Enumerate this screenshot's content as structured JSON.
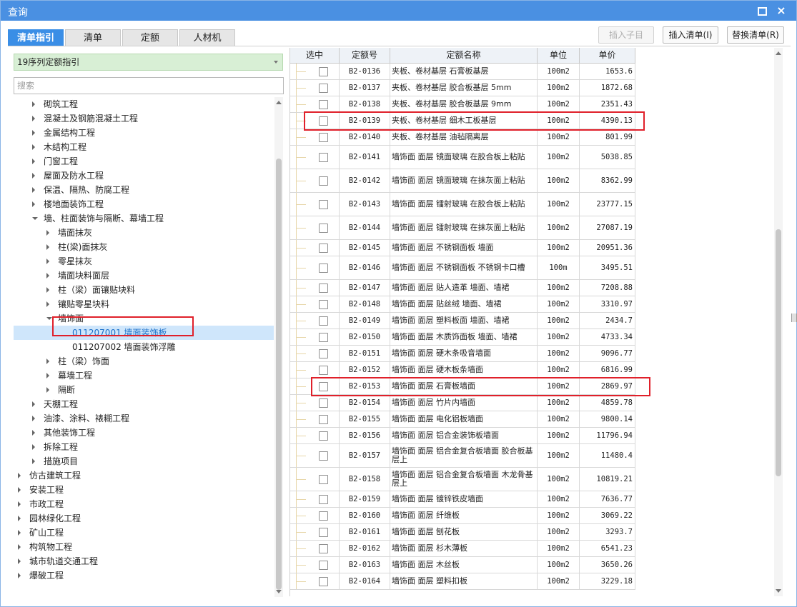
{
  "window": {
    "title": "查询"
  },
  "tabs": [
    {
      "label": "清单指引",
      "active": true
    },
    {
      "label": "清单",
      "active": false
    },
    {
      "label": "定额",
      "active": false
    },
    {
      "label": "人材机",
      "active": false
    }
  ],
  "toolbar": {
    "insert_child_label": "插入子目",
    "insert_list_label": "插入清单(I)",
    "replace_list_label": "替换清单(R)"
  },
  "left": {
    "dropdown_value": "19序列定额指引",
    "search_placeholder": "搜索"
  },
  "tree": [
    {
      "label": "砌筑工程",
      "level": 1,
      "state": "collapsed"
    },
    {
      "label": "混凝土及钢筋混凝土工程",
      "level": 1,
      "state": "collapsed"
    },
    {
      "label": "金属结构工程",
      "level": 1,
      "state": "collapsed"
    },
    {
      "label": "木结构工程",
      "level": 1,
      "state": "collapsed"
    },
    {
      "label": "门窗工程",
      "level": 1,
      "state": "collapsed"
    },
    {
      "label": "屋面及防水工程",
      "level": 1,
      "state": "collapsed"
    },
    {
      "label": "保温、隔热、防腐工程",
      "level": 1,
      "state": "collapsed"
    },
    {
      "label": "楼地面装饰工程",
      "level": 1,
      "state": "collapsed"
    },
    {
      "label": "墙、柱面装饰与隔断、幕墙工程",
      "level": 1,
      "state": "expanded"
    },
    {
      "label": "墙面抹灰",
      "level": 2,
      "state": "collapsed"
    },
    {
      "label": "柱(梁)面抹灰",
      "level": 2,
      "state": "collapsed"
    },
    {
      "label": "零星抹灰",
      "level": 2,
      "state": "collapsed"
    },
    {
      "label": "墙面块料面层",
      "level": 2,
      "state": "collapsed"
    },
    {
      "label": "柱（梁）面镶贴块料",
      "level": 2,
      "state": "collapsed"
    },
    {
      "label": "镶贴零星块料",
      "level": 2,
      "state": "collapsed"
    },
    {
      "label": "墙饰面",
      "level": 2,
      "state": "expanded"
    },
    {
      "label": "011207001  墙面装饰板",
      "level": 3,
      "state": "leaf",
      "selected": true,
      "highlighted": true
    },
    {
      "label": "011207002  墙面装饰浮雕",
      "level": 3,
      "state": "leaf"
    },
    {
      "label": "柱（梁）饰面",
      "level": 2,
      "state": "collapsed"
    },
    {
      "label": "幕墙工程",
      "level": 2,
      "state": "collapsed"
    },
    {
      "label": "隔断",
      "level": 2,
      "state": "collapsed"
    },
    {
      "label": "天棚工程",
      "level": 1,
      "state": "collapsed"
    },
    {
      "label": "油漆、涂料、裱糊工程",
      "level": 1,
      "state": "collapsed"
    },
    {
      "label": "其他装饰工程",
      "level": 1,
      "state": "collapsed"
    },
    {
      "label": "拆除工程",
      "level": 1,
      "state": "collapsed"
    },
    {
      "label": "措施项目",
      "level": 1,
      "state": "collapsed"
    },
    {
      "label": "仿古建筑工程",
      "level": 0,
      "state": "collapsed"
    },
    {
      "label": "安装工程",
      "level": 0,
      "state": "collapsed"
    },
    {
      "label": "市政工程",
      "level": 0,
      "state": "collapsed"
    },
    {
      "label": "园林绿化工程",
      "level": 0,
      "state": "collapsed"
    },
    {
      "label": "矿山工程",
      "level": 0,
      "state": "collapsed"
    },
    {
      "label": "构筑物工程",
      "level": 0,
      "state": "collapsed"
    },
    {
      "label": "城市轨道交通工程",
      "level": 0,
      "state": "collapsed"
    },
    {
      "label": "爆破工程",
      "level": 0,
      "state": "collapsed"
    }
  ],
  "grid": {
    "headers": [
      "选中",
      "定额号",
      "定额名称",
      "单位",
      "单价"
    ],
    "rows": [
      {
        "code": "B2-0136",
        "name": "夹板、卷材基层 石膏板基层",
        "unit": "100m2",
        "price": "1653.6"
      },
      {
        "code": "B2-0137",
        "name": "夹板、卷材基层 胶合板基层 5mm",
        "unit": "100m2",
        "price": "1872.68"
      },
      {
        "code": "B2-0138",
        "name": "夹板、卷材基层 胶合板基层 9mm",
        "unit": "100m2",
        "price": "2351.43"
      },
      {
        "code": "B2-0139",
        "name": "夹板、卷材基层 细木工板基层",
        "unit": "100m2",
        "price": "4390.13",
        "highlighted": true
      },
      {
        "code": "B2-0140",
        "name": "夹板、卷材基层 油毡隔离层",
        "unit": "100m2",
        "price": "801.99"
      },
      {
        "code": "B2-0141",
        "name": "墙饰面 面层 镜面玻璃 在胶合板上粘贴",
        "unit": "100m2",
        "price": "5038.85",
        "tall": true
      },
      {
        "code": "B2-0142",
        "name": "墙饰面 面层 镜面玻璃 在抹灰面上粘贴",
        "unit": "100m2",
        "price": "8362.99",
        "tall": true
      },
      {
        "code": "B2-0143",
        "name": "墙饰面 面层 镭射玻璃 在胶合板上粘贴",
        "unit": "100m2",
        "price": "23777.15",
        "tall": true
      },
      {
        "code": "B2-0144",
        "name": "墙饰面 面层 镭射玻璃 在抹灰面上粘贴",
        "unit": "100m2",
        "price": "27087.19",
        "tall": true
      },
      {
        "code": "B2-0145",
        "name": "墙饰面 面层 不锈钢面板 墙面",
        "unit": "100m2",
        "price": "20951.36"
      },
      {
        "code": "B2-0146",
        "name": "墙饰面 面层 不锈钢面板 不锈钢卡口槽",
        "unit": "100m",
        "price": "3495.51",
        "tall": true
      },
      {
        "code": "B2-0147",
        "name": "墙饰面 面层 贴人造革 墙面、墙裙",
        "unit": "100m2",
        "price": "7208.88"
      },
      {
        "code": "B2-0148",
        "name": "墙饰面 面层 贴丝绒 墙面、墙裙",
        "unit": "100m2",
        "price": "3310.97"
      },
      {
        "code": "B2-0149",
        "name": "墙饰面 面层 塑料板面 墙面、墙裙",
        "unit": "100m2",
        "price": "2434.7"
      },
      {
        "code": "B2-0150",
        "name": "墙饰面 面层 木质饰面板 墙面、墙裙",
        "unit": "100m2",
        "price": "4733.34"
      },
      {
        "code": "B2-0151",
        "name": "墙饰面 面层 硬木条吸音墙面",
        "unit": "100m2",
        "price": "9096.77"
      },
      {
        "code": "B2-0152",
        "name": "墙饰面 面层 硬木板条墙面",
        "unit": "100m2",
        "price": "6816.99"
      },
      {
        "code": "B2-0153",
        "name": "墙饰面 面层 石膏板墙面",
        "unit": "100m2",
        "price": "2869.97",
        "highlighted": true
      },
      {
        "code": "B2-0154",
        "name": "墙饰面 面层 竹片内墙面",
        "unit": "100m2",
        "price": "4859.78"
      },
      {
        "code": "B2-0155",
        "name": "墙饰面 面层 电化铝板墙面",
        "unit": "100m2",
        "price": "9800.14"
      },
      {
        "code": "B2-0156",
        "name": "墙饰面 面层 铝合金装饰板墙面",
        "unit": "100m2",
        "price": "11796.94"
      },
      {
        "code": "B2-0157",
        "name": "墙饰面 面层 铝合金复合板墙面 胶合板基层上",
        "unit": "100m2",
        "price": "11480.4",
        "tall": true
      },
      {
        "code": "B2-0158",
        "name": "墙饰面 面层 铝合金复合板墙面 木龙骨基层上",
        "unit": "100m2",
        "price": "10819.21",
        "tall": true
      },
      {
        "code": "B2-0159",
        "name": "墙饰面 面层 镀锌铁皮墙面",
        "unit": "100m2",
        "price": "7636.77"
      },
      {
        "code": "B2-0160",
        "name": "墙饰面 面层 纤维板",
        "unit": "100m2",
        "price": "3069.22"
      },
      {
        "code": "B2-0161",
        "name": "墙饰面 面层 刨花板",
        "unit": "100m2",
        "price": "3293.7"
      },
      {
        "code": "B2-0162",
        "name": "墙饰面 面层 杉木薄板",
        "unit": "100m2",
        "price": "6541.23"
      },
      {
        "code": "B2-0163",
        "name": "墙饰面 面层 木丝板",
        "unit": "100m2",
        "price": "3650.26"
      },
      {
        "code": "B2-0164",
        "name": "墙饰面 面层 塑料扣板",
        "unit": "100m2",
        "price": "3229.18"
      }
    ]
  }
}
